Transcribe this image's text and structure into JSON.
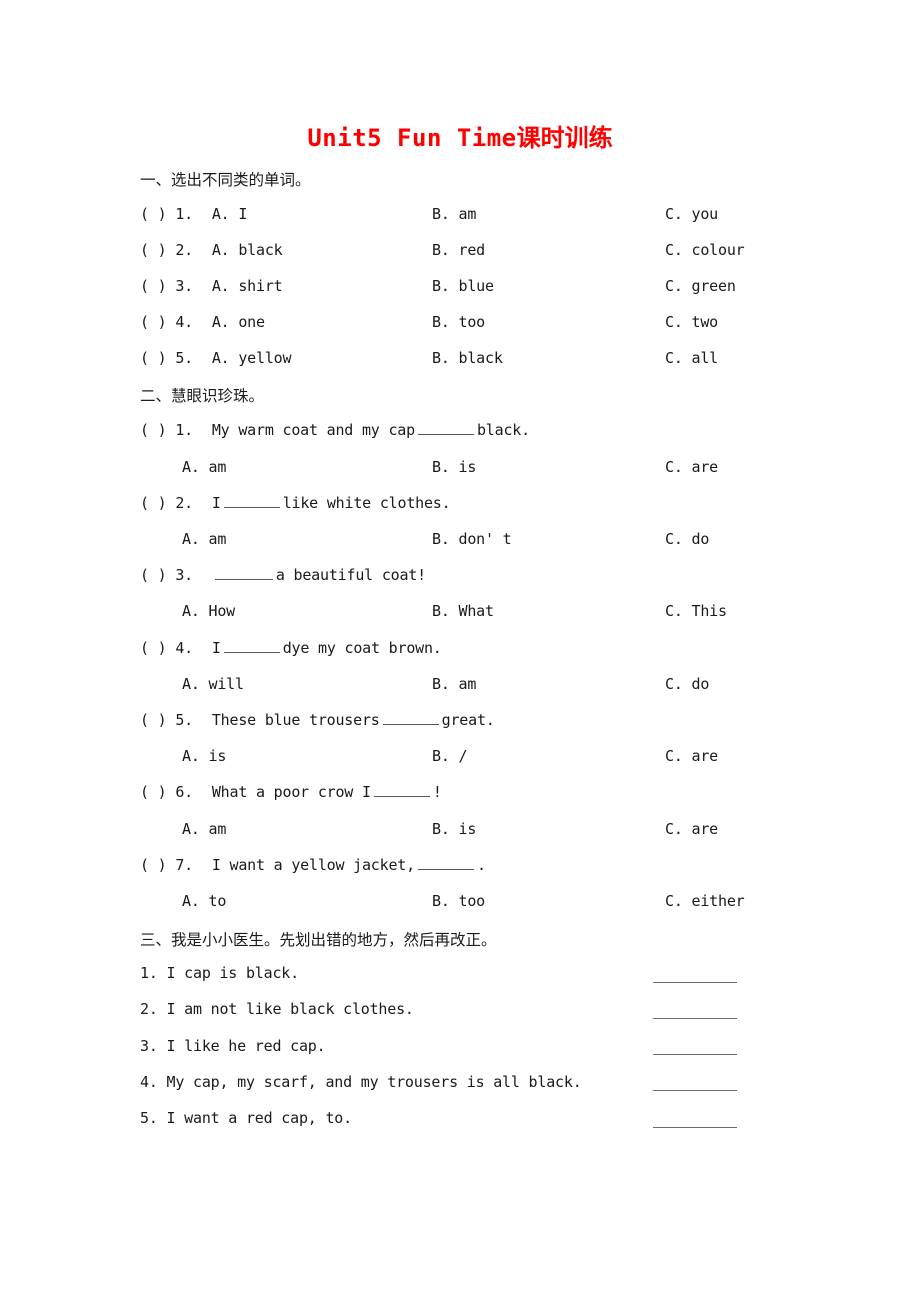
{
  "document": {
    "title_en": "Unit5 Fun Time",
    "title_cn": "课时训练"
  },
  "sections": [
    {
      "id": "section-1",
      "heading": "一、选出不同类的单词。",
      "questions": [
        {
          "stem": "（ ）1. A. I",
          "a": "A. I",
          "b": "B. am",
          "c": "C. you"
        },
        {
          "stem": "（ ）2. A. black",
          "a": "A. black",
          "b": "B. red",
          "c": "C. colour"
        },
        {
          "stem": "（ ）3. A. shirt",
          "a": "A. shirt",
          "b": "B. blue",
          "c": "C. green"
        },
        {
          "stem": "（ ）4. A. one",
          "a": "A. one",
          "b": "B. too",
          "c": "C. two"
        },
        {
          "stem": "（ ）5. A. yellow",
          "a": "A. yellow",
          "b": "B. black",
          "c": "C. all"
        }
      ],
      "rows": [
        {
          "mark": "(  ) 1.",
          "a": "A.  I",
          "b": "B.  am",
          "c": "C.  you"
        },
        {
          "mark": "(  ) 2.",
          "a": "A.  black",
          "b": "B.  red",
          "c": "C.  colour"
        },
        {
          "mark": "(  ) 3.",
          "a": "A.  shirt",
          "b": "B.  blue",
          "c": "C.  green"
        },
        {
          "mark": "(  ) 4.",
          "a": "A.  one",
          "b": "B.  too",
          "c": "C.  two"
        },
        {
          "mark": "(  ) 5.",
          "a": "A.  yellow",
          "b": "B.  black",
          "c": "C.  all"
        }
      ]
    },
    {
      "id": "section-2",
      "heading": "二、慧眼识珍珠。",
      "items": [
        {
          "mark": "(  ) 1.",
          "stem_before": "My warm coat and my cap",
          "stem_after": "black.",
          "a": "A.  am",
          "b": "B.  is",
          "c": "C.  are"
        },
        {
          "mark": "(  ) 2.",
          "stem_before": "I",
          "stem_after": "like white clothes.",
          "a": "A.  am",
          "b": "B.  don' t",
          "c": "C.  do"
        },
        {
          "mark": "(  ) 3.",
          "stem_before": "",
          "stem_after": "a beautiful coat!",
          "a": "A.  How",
          "b": "B.  What",
          "c": "C.  This"
        },
        {
          "mark": "(  ) 4.",
          "stem_before": "I",
          "stem_after": "dye my coat brown.",
          "a": "A.  will",
          "b": "B.  am",
          "c": "C.  do"
        },
        {
          "mark": "(  ) 5.",
          "stem_before": "These blue trousers",
          "stem_after": "great.",
          "a": "A.  is",
          "b": "B.  /",
          "c": "C.  are"
        },
        {
          "mark": "(  ) 6.",
          "stem_before": "What a poor crow I",
          "stem_after": "!",
          "a": "A.  am",
          "b": "B.  is",
          "c": "C.  are"
        },
        {
          "mark": "(  ) 7.",
          "stem_before": "I want a yellow jacket,",
          "stem_after": ".",
          "a": "A.  to",
          "b": "B.  too",
          "c": "C.  either"
        }
      ]
    },
    {
      "id": "section-3",
      "heading": "三、我是小小医生。先划出错的地方，然后再改正。",
      "items": [
        {
          "text": "1.  I cap is black."
        },
        {
          "text": "2.  I am not like black clothes."
        },
        {
          "text": "3.  I like he red cap."
        },
        {
          "text": "4.  My cap, my scarf, and my trousers is all black."
        },
        {
          "text": "5.  I want a red cap, to."
        }
      ]
    }
  ],
  "colors": {
    "title": "#ff0000",
    "text": "#1a1a1a",
    "rule": "#6b6b73"
  }
}
